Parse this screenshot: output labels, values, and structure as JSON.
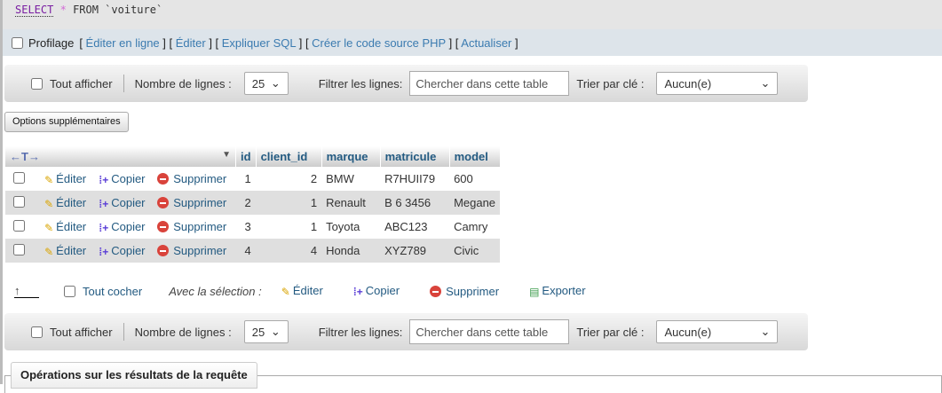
{
  "sql": {
    "select": "SELECT",
    "star": "*",
    "rest": "FROM `voiture`"
  },
  "profiling": {
    "label": "Profilage",
    "links": [
      "Éditer en ligne",
      "Éditer",
      "Expliquer SQL",
      "Créer le code source PHP",
      "Actualiser"
    ]
  },
  "nav": {
    "show_all": "Tout afficher",
    "rows_label": "Nombre de lignes :",
    "rows_value": "25",
    "filter_label": "Filtrer les lignes:",
    "filter_placeholder": "Chercher dans cette table",
    "sort_label": "Trier par clé :",
    "sort_value": "Aucun(e)"
  },
  "options_button": "Options supplémentaires",
  "table": {
    "columns": [
      "id",
      "client_id",
      "marque",
      "matricule",
      "model"
    ],
    "actions": {
      "edit": "Éditer",
      "copy": "Copier",
      "delete": "Supprimer"
    },
    "rows": [
      [
        "1",
        "2",
        "BMW",
        "R7HUII79",
        "600"
      ],
      [
        "2",
        "1",
        "Renault",
        "B 6 3456",
        "Megane"
      ],
      [
        "3",
        "1",
        "Toyota",
        "ABC123",
        "Camry"
      ],
      [
        "4",
        "4",
        "Honda",
        "XYZ789",
        "Civic"
      ]
    ]
  },
  "bulk": {
    "check_all": "Tout cocher",
    "with_selection": "Avec la sélection :",
    "edit": "Éditer",
    "copy": "Copier",
    "delete": "Supprimer",
    "export": "Exporter"
  },
  "operations_legend": "Opérations sur les résultats de la requête"
}
